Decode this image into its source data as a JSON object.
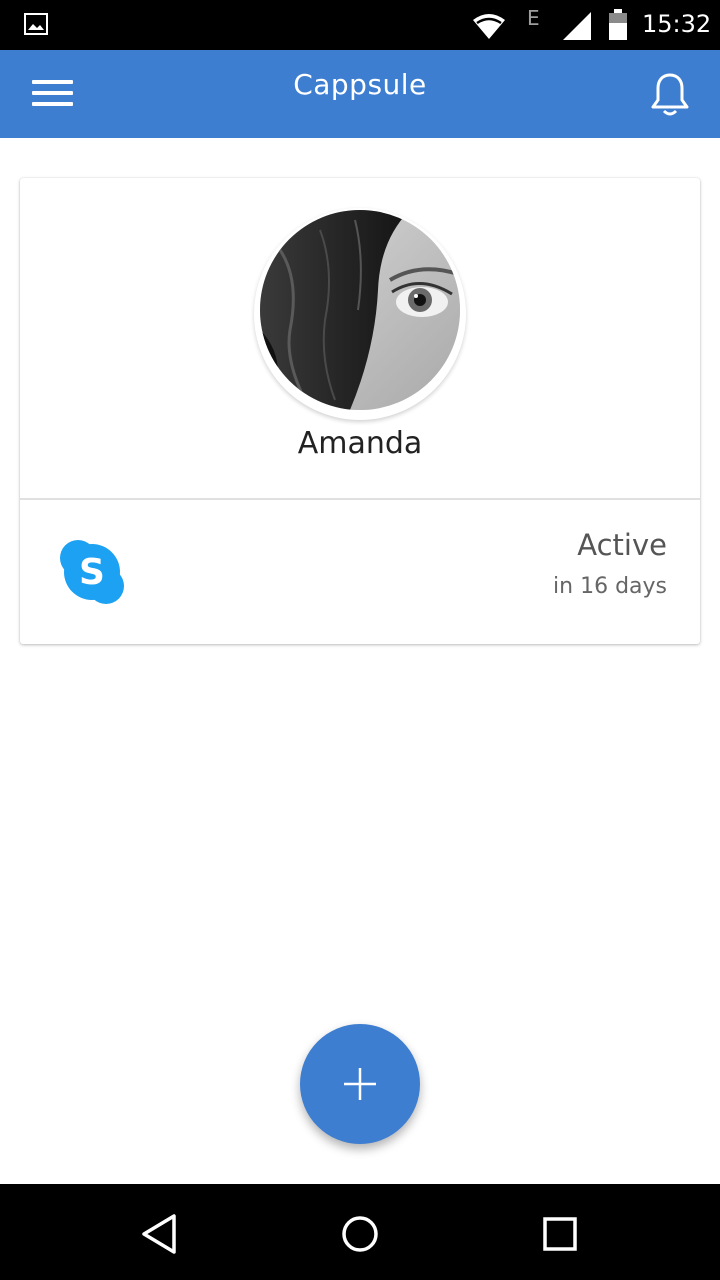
{
  "status_bar": {
    "network_type": "E",
    "time": "15:32",
    "icons": [
      "gallery-icon",
      "wifi-icon",
      "signal-icon",
      "battery-icon"
    ]
  },
  "app_bar": {
    "title": "Cappsule",
    "menu_icon": "hamburger-menu-icon",
    "notification_icon": "bell-icon"
  },
  "contact_card": {
    "name": "Amanda",
    "service_icon": "skype-icon",
    "status": "Active",
    "status_detail": "in 16 days"
  },
  "fab": {
    "icon": "plus-icon"
  },
  "nav_bar": {
    "buttons": [
      "back-icon",
      "home-icon",
      "recents-icon"
    ]
  },
  "colors": {
    "primary": "#3d7ed1",
    "skype": "#1da1f2",
    "status_bar": "#000000"
  }
}
